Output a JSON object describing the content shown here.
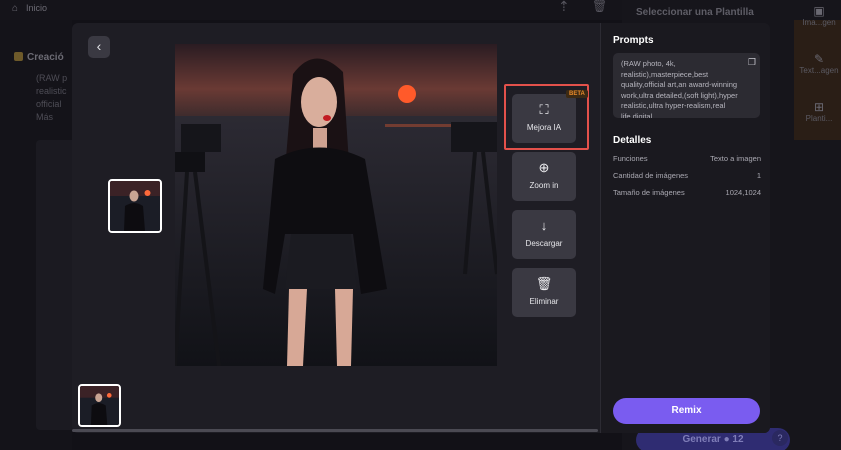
{
  "background": {
    "home_label": "Inicio",
    "left_title": "Creació",
    "left_lines": [
      "(RAW p",
      "realistic",
      "official",
      "Más"
    ],
    "template_header": "Seleccionar una Plantilla",
    "rail_items": [
      {
        "icon": "image-icon",
        "label": "Ima...gen"
      },
      {
        "icon": "text-image-icon",
        "label": "Text...agen"
      },
      {
        "icon": "template-icon",
        "label": "Planti..."
      }
    ],
    "generate_label": "Generar",
    "credit_count": "12"
  },
  "modal": {
    "back_icon": "chevron-left-icon",
    "actions": [
      {
        "icon": "enhance-icon",
        "label": "Mejora IA",
        "badge": "BETA",
        "highlighted": true
      },
      {
        "icon": "zoom-in-icon",
        "label": "Zoom in"
      },
      {
        "icon": "download-icon",
        "label": "Descargar"
      },
      {
        "icon": "trash-icon",
        "label": "Eliminar"
      }
    ],
    "panel": {
      "prompts_title": "Prompts",
      "prompt_text": "(RAW photo, 4k, realistic),masterpiece,best quality,official art,an award-winning work,ultra detailed,(soft light),hyper realistic,ultra hyper-realism,real life,digital",
      "details_title": "Detalles",
      "details": [
        {
          "label": "Funciones",
          "value": "Texto a imagen"
        },
        {
          "label": "Cantidad de imágenes",
          "value": "1"
        },
        {
          "label": "Tamaño de imágenes",
          "value": "1024,1024"
        }
      ],
      "remix_label": "Remix"
    }
  },
  "colors": {
    "accent": "#7a5cf0",
    "highlight_border": "#e3514b",
    "beta_text": "#e88a2a"
  }
}
